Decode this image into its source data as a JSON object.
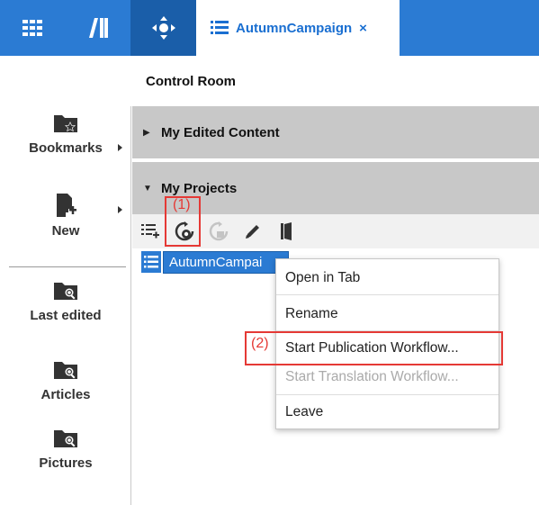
{
  "topbar": {
    "apps_icon": "grid-icon",
    "library_icon": "library-icon",
    "control_room_icon": "compass-move-icon",
    "tab": {
      "icon": "list-icon",
      "label": "AutumnCampaign",
      "close": "×"
    }
  },
  "breadcrumb": "Control Room",
  "sidebar": {
    "items": [
      {
        "label": "Bookmarks",
        "icon": "folder-star-icon",
        "has_submenu": true
      },
      {
        "label": "New",
        "icon": "new-document-icon",
        "has_submenu": true
      },
      {
        "label": "Last edited",
        "icon": "folder-search-icon",
        "has_submenu": false
      },
      {
        "label": "Articles",
        "icon": "folder-search-icon",
        "has_submenu": false
      },
      {
        "label": "Pictures",
        "icon": "folder-search-icon",
        "has_submenu": false
      }
    ]
  },
  "panels": {
    "edited": {
      "title": "My Edited Content",
      "expanded": false
    },
    "projects": {
      "title": "My Projects",
      "expanded": true
    }
  },
  "toolbar": {
    "icons": [
      "add-list-icon",
      "workflow-icon",
      "workflow-disabled-icon",
      "pencil-icon",
      "leave-icon"
    ]
  },
  "project_row": {
    "label": "AutumnCampai"
  },
  "context_menu": {
    "items": [
      {
        "label": "Open in Tab",
        "enabled": true
      },
      {
        "label": "Rename",
        "enabled": true
      },
      {
        "label": "Start Publication Workflow...",
        "enabled": true
      },
      {
        "label": "Start Translation Workflow...",
        "enabled": false
      },
      {
        "label": "Leave",
        "enabled": true
      }
    ]
  },
  "annotations": {
    "step1": "(1)",
    "step2": "(2)"
  },
  "colors": {
    "accent": "#2b7bd3",
    "accent_dark": "#1a5ea9",
    "annotation": "#e53935",
    "panel_header": "#c8c8c8"
  }
}
